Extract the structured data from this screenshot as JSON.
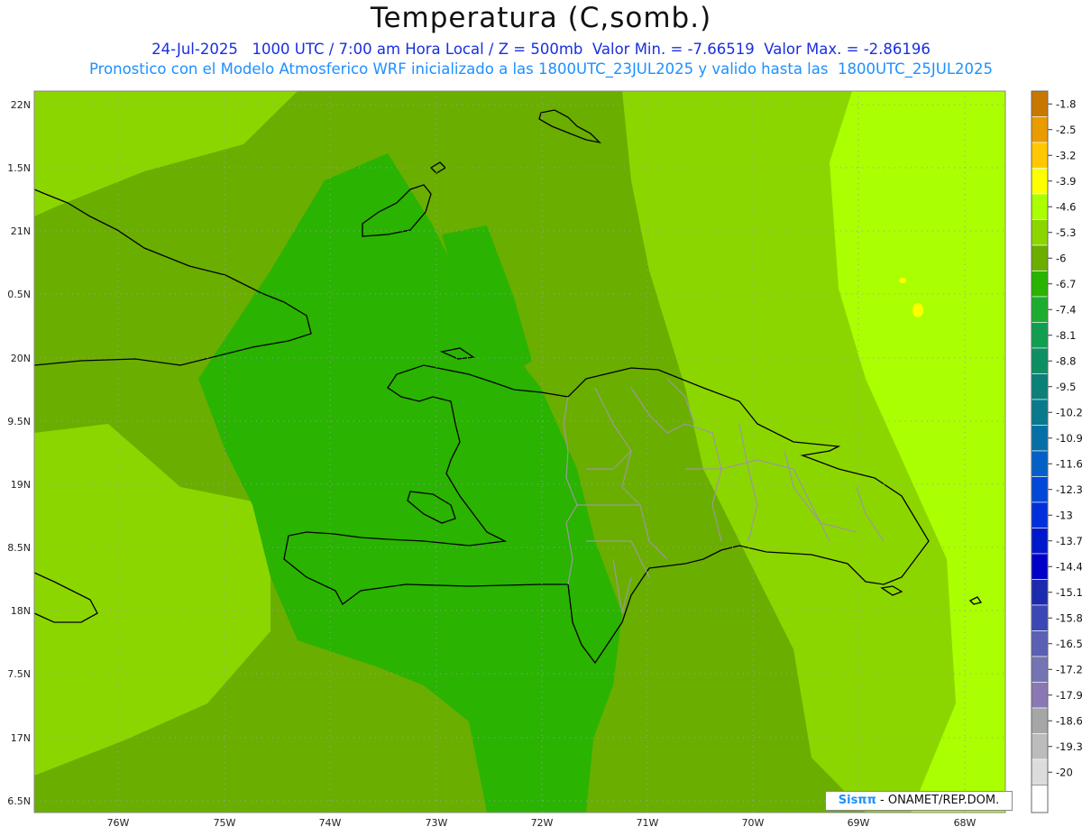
{
  "header": {
    "title": "Temperatura (C,somb.)",
    "line1": "24-Jul-2025   1000 UTC / 7:00 am Hora Local / Z = 500mb  Valor Min. = -7.66519  Valor Max. = -2.86196",
    "line2": "Pronostico con el Modelo Atmosferico WRF inicializado a las 1800UTC_23JUL2025 y valido hasta las  1800UTC_25JUL2025"
  },
  "axes": {
    "lat_labels": [
      "22N",
      "1.5N",
      "21N",
      "0.5N",
      "20N",
      "9.5N",
      "19N",
      "8.5N",
      "18N",
      "7.5N",
      "17N",
      "6.5N"
    ],
    "lon_labels": [
      "76W",
      "75W",
      "74W",
      "73W",
      "72W",
      "71W",
      "70W",
      "69W",
      "68W"
    ]
  },
  "colorbar": {
    "levels": [
      {
        "label": "-1.8",
        "color": "#c87800"
      },
      {
        "label": "-2.5",
        "color": "#e99b00"
      },
      {
        "label": "-3.2",
        "color": "#ffc800"
      },
      {
        "label": "-3.9",
        "color": "#ffff00"
      },
      {
        "label": "-4.6",
        "color": "#aaff00"
      },
      {
        "label": "-5.3",
        "color": "#8cd600"
      },
      {
        "label": "-6",
        "color": "#6aae00"
      },
      {
        "label": "-6.7",
        "color": "#2ab300"
      },
      {
        "label": "-7.4",
        "color": "#1cad30"
      },
      {
        "label": "-8.1",
        "color": "#129e50"
      },
      {
        "label": "-8.8",
        "color": "#0e8e64"
      },
      {
        "label": "-9.5",
        "color": "#0a8078"
      },
      {
        "label": "-10.2",
        "color": "#087a8c"
      },
      {
        "label": "-10.9",
        "color": "#0570a8"
      },
      {
        "label": "-11.6",
        "color": "#0460c8"
      },
      {
        "label": "-12.3",
        "color": "#0048d8"
      },
      {
        "label": "-13",
        "color": "#0030dc"
      },
      {
        "label": "-13.7",
        "color": "#0018cc"
      },
      {
        "label": "-14.4",
        "color": "#0000c8"
      },
      {
        "label": "-15.1",
        "color": "#1c2aae"
      },
      {
        "label": "-15.8",
        "color": "#3c46b4"
      },
      {
        "label": "-16.5",
        "color": "#5a60b4"
      },
      {
        "label": "-17.2",
        "color": "#7474b4"
      },
      {
        "label": "-17.9",
        "color": "#8a78b4"
      },
      {
        "label": "-18.6",
        "color": "#a6a6a6"
      },
      {
        "label": "-19.3",
        "color": "#bcbcbc"
      },
      {
        "label": "-20",
        "color": "#dcdcdc"
      }
    ],
    "bottom_color": "#ffffff"
  },
  "credit": {
    "prefix": "Sisππ",
    "text": "- ONAMET/REP.DOM."
  },
  "colors": {
    "field_base": "#6aae00",
    "field_dark": "#2ab300",
    "field_light": "#8cd600",
    "field_east": "#aaff00",
    "yellow_spot": "#ffff00"
  }
}
